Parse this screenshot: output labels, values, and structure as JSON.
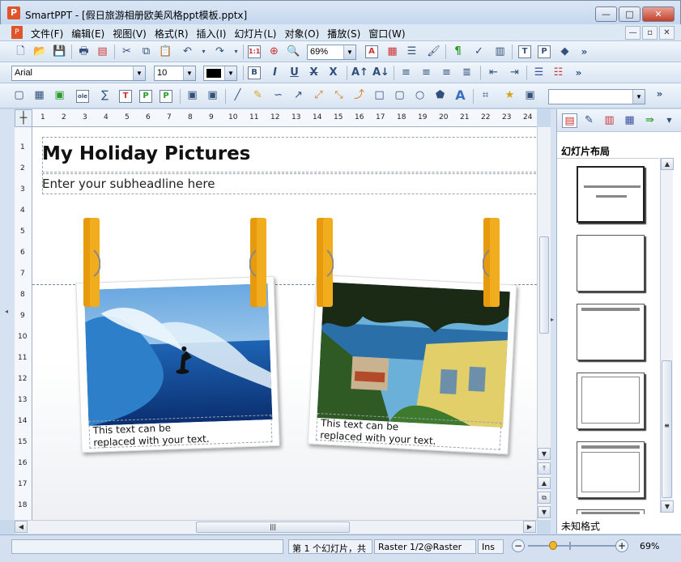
{
  "window": {
    "title": "SmartPPT - [假日旅游相册欧美风格ppt模板.pptx]",
    "minimize": "—",
    "maximize": "□",
    "close": "✕"
  },
  "menu": {
    "items": [
      "文件(F)",
      "编辑(E)",
      "视图(V)",
      "格式(R)",
      "插入(I)",
      "幻灯片(L)",
      "对象(O)",
      "播放(S)",
      "窗口(W)"
    ]
  },
  "toolbar": {
    "zoom_value": "69%",
    "font_name": "Arial",
    "font_size": "10",
    "more": "»"
  },
  "ruler": {
    "h_marks": [
      "1",
      "2",
      "3",
      "4",
      "5",
      "6",
      "7",
      "8",
      "9",
      "10",
      "11",
      "12",
      "13",
      "14",
      "15",
      "16",
      "17",
      "18",
      "19",
      "20",
      "21",
      "22",
      "23",
      "24"
    ],
    "v_marks": [
      "1",
      "2",
      "3",
      "4",
      "5",
      "6",
      "7",
      "8",
      "9",
      "10",
      "11",
      "12",
      "13",
      "14",
      "15",
      "16",
      "17",
      "18"
    ]
  },
  "slide": {
    "title": "My Holiday Pictures",
    "subtitle": "Enter your subheadline here",
    "photo1_caption_line1": "This text can be",
    "photo1_caption_line2": "replaced with your text.",
    "photo2_caption_line1": "This text can be",
    "photo2_caption_line2": "replaced with your text."
  },
  "right_panel": {
    "heading": "幻灯片布局",
    "footer": "未知格式"
  },
  "status": {
    "slide_info": "第 1 个幻灯片，共",
    "raster": "Raster 1/2@Raster",
    "mode": "Ins",
    "zoom": "69%"
  },
  "colors": {
    "clip": "#e89a0e",
    "accent_red": "#e0542a",
    "ocean": "#2b6bb8"
  }
}
